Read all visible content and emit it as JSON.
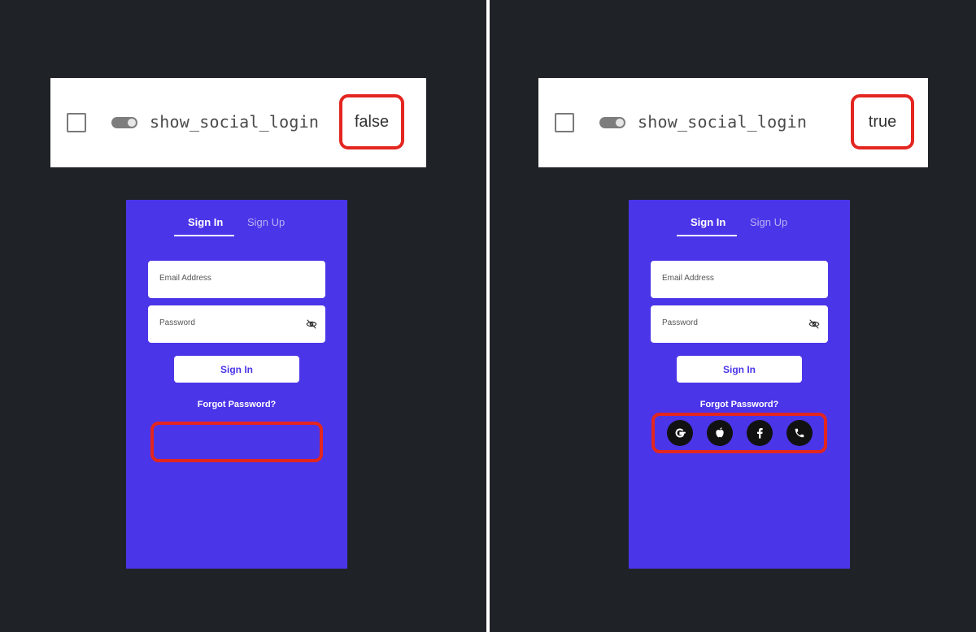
{
  "flag": {
    "name": "show_social_login",
    "left_value": "false",
    "right_value": "true"
  },
  "login": {
    "tabs": [
      "Sign In",
      "Sign Up"
    ],
    "email_placeholder": "Email Address",
    "password_placeholder": "Password",
    "signin_label": "Sign In",
    "forgot_label": "Forgot Password?"
  },
  "social": [
    "google-icon",
    "apple-icon",
    "facebook-icon",
    "phone-icon"
  ],
  "colors": {
    "background": "#1f2328",
    "phone": "#4b35e8",
    "highlight": "#e3261f",
    "social_button": "#111111"
  }
}
